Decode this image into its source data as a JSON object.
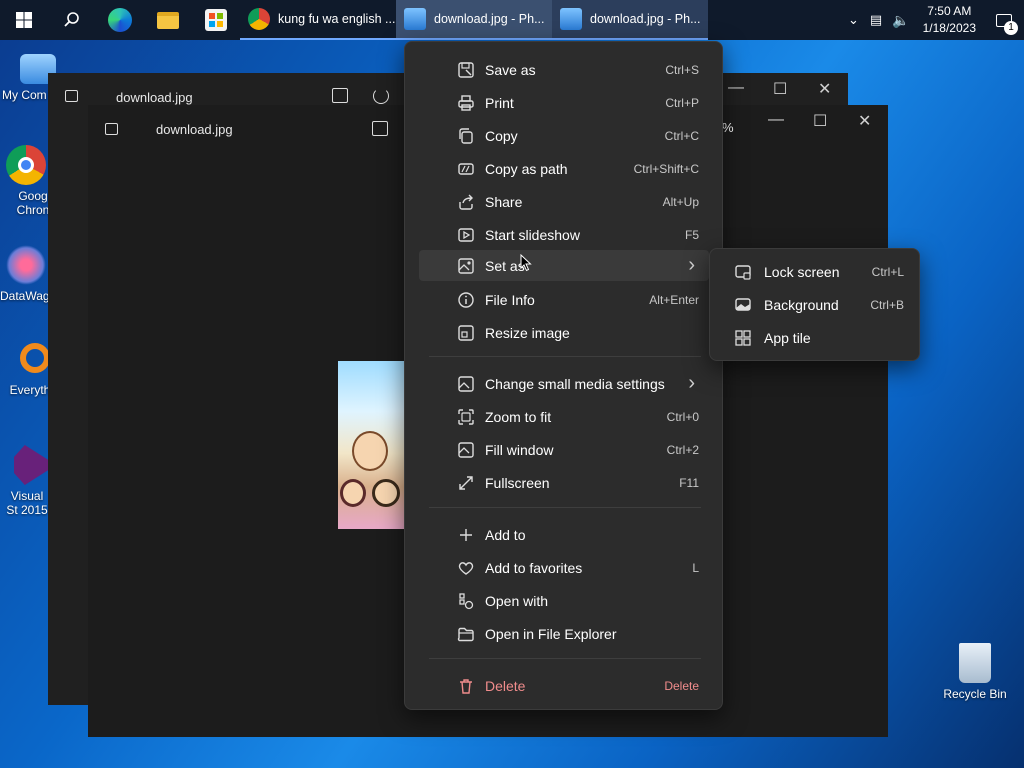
{
  "taskbar": {
    "tasks": [
      {
        "label": "kung fu wa english ..."
      },
      {
        "label": "download.jpg - Ph..."
      },
      {
        "label": "download.jpg - Ph..."
      }
    ],
    "time": "7:50 AM",
    "date": "1/18/2023",
    "notification_count": "1"
  },
  "desktop": {
    "icons": [
      {
        "label": "My Com"
      },
      {
        "label": "Goog Chron"
      },
      {
        "label": "DataWag"
      },
      {
        "label": "Everyth"
      },
      {
        "label": "Visual St 2015"
      },
      {
        "label": "Recycle Bin"
      }
    ]
  },
  "windows": {
    "back_title": "download.jpg",
    "front_title": "download.jpg",
    "zoom_partial": "%"
  },
  "menu": {
    "items": [
      {
        "label": "Save as",
        "shortcut": "Ctrl+S",
        "icon": "save-icon"
      },
      {
        "label": "Print",
        "shortcut": "Ctrl+P",
        "icon": "print-icon"
      },
      {
        "label": "Copy",
        "shortcut": "Ctrl+C",
        "icon": "copy-icon"
      },
      {
        "label": "Copy as path",
        "shortcut": "Ctrl+Shift+C",
        "icon": "copy-path-icon"
      },
      {
        "label": "Share",
        "shortcut": "Alt+Up",
        "icon": "share-icon"
      },
      {
        "label": "Start slideshow",
        "shortcut": "F5",
        "icon": "slideshow-icon"
      },
      {
        "label": "Set as",
        "shortcut": "",
        "icon": "set-as-icon"
      },
      {
        "label": "File Info",
        "shortcut": "Alt+Enter",
        "icon": "info-icon"
      },
      {
        "label": "Resize image",
        "shortcut": "",
        "icon": "resize-icon"
      },
      {
        "label": "Change small media settings",
        "shortcut": "",
        "icon": "media-settings-icon"
      },
      {
        "label": "Zoom to fit",
        "shortcut": "Ctrl+0",
        "icon": "zoom-fit-icon"
      },
      {
        "label": "Fill window",
        "shortcut": "Ctrl+2",
        "icon": "fill-window-icon"
      },
      {
        "label": "Fullscreen",
        "shortcut": "F11",
        "icon": "fullscreen-icon"
      },
      {
        "label": "Add to",
        "shortcut": "",
        "icon": "plus-icon"
      },
      {
        "label": "Add to favorites",
        "shortcut": "L",
        "icon": "heart-icon"
      },
      {
        "label": "Open with",
        "shortcut": "",
        "icon": "open-with-icon"
      },
      {
        "label": "Open in File Explorer",
        "shortcut": "",
        "icon": "folder-icon"
      },
      {
        "label": "Delete",
        "shortcut": "Delete",
        "icon": "trash-icon"
      }
    ]
  },
  "submenu": {
    "items": [
      {
        "label": "Lock screen",
        "shortcut": "Ctrl+L",
        "icon": "lock-screen-icon"
      },
      {
        "label": "Background",
        "shortcut": "Ctrl+B",
        "icon": "background-icon"
      },
      {
        "label": "App tile",
        "shortcut": "",
        "icon": "app-tile-icon"
      }
    ]
  },
  "colors": {
    "menu_bg": "#2c2c2c",
    "danger": "#f08c8c",
    "taskbar": "#0f1a2b"
  }
}
